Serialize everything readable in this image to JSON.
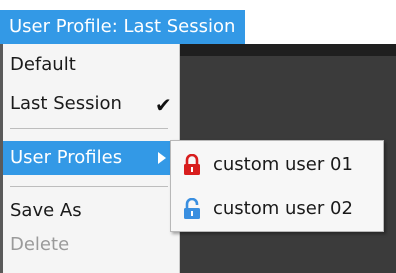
{
  "header": {
    "profile_button": "User Profile: Last Session"
  },
  "menu": {
    "items": [
      {
        "label": "Default"
      },
      {
        "label": "Last Session",
        "checked": true,
        "check_glyph": "✔"
      },
      {
        "label": "User Profiles",
        "highlighted": true,
        "has_submenu": true
      },
      {
        "label": "Save As"
      },
      {
        "label": "Delete",
        "disabled": true
      }
    ]
  },
  "submenu": {
    "items": [
      {
        "label": "custom user 01",
        "icon": "lock-closed-icon",
        "icon_color": "#d81e1e"
      },
      {
        "label": "custom user 02",
        "icon": "lock-open-icon",
        "icon_color": "#3a8fe0"
      }
    ]
  },
  "colors": {
    "accent": "#3399e6",
    "menu_bg": "#f5f5f5",
    "disabled_text": "#9a9a9a"
  }
}
